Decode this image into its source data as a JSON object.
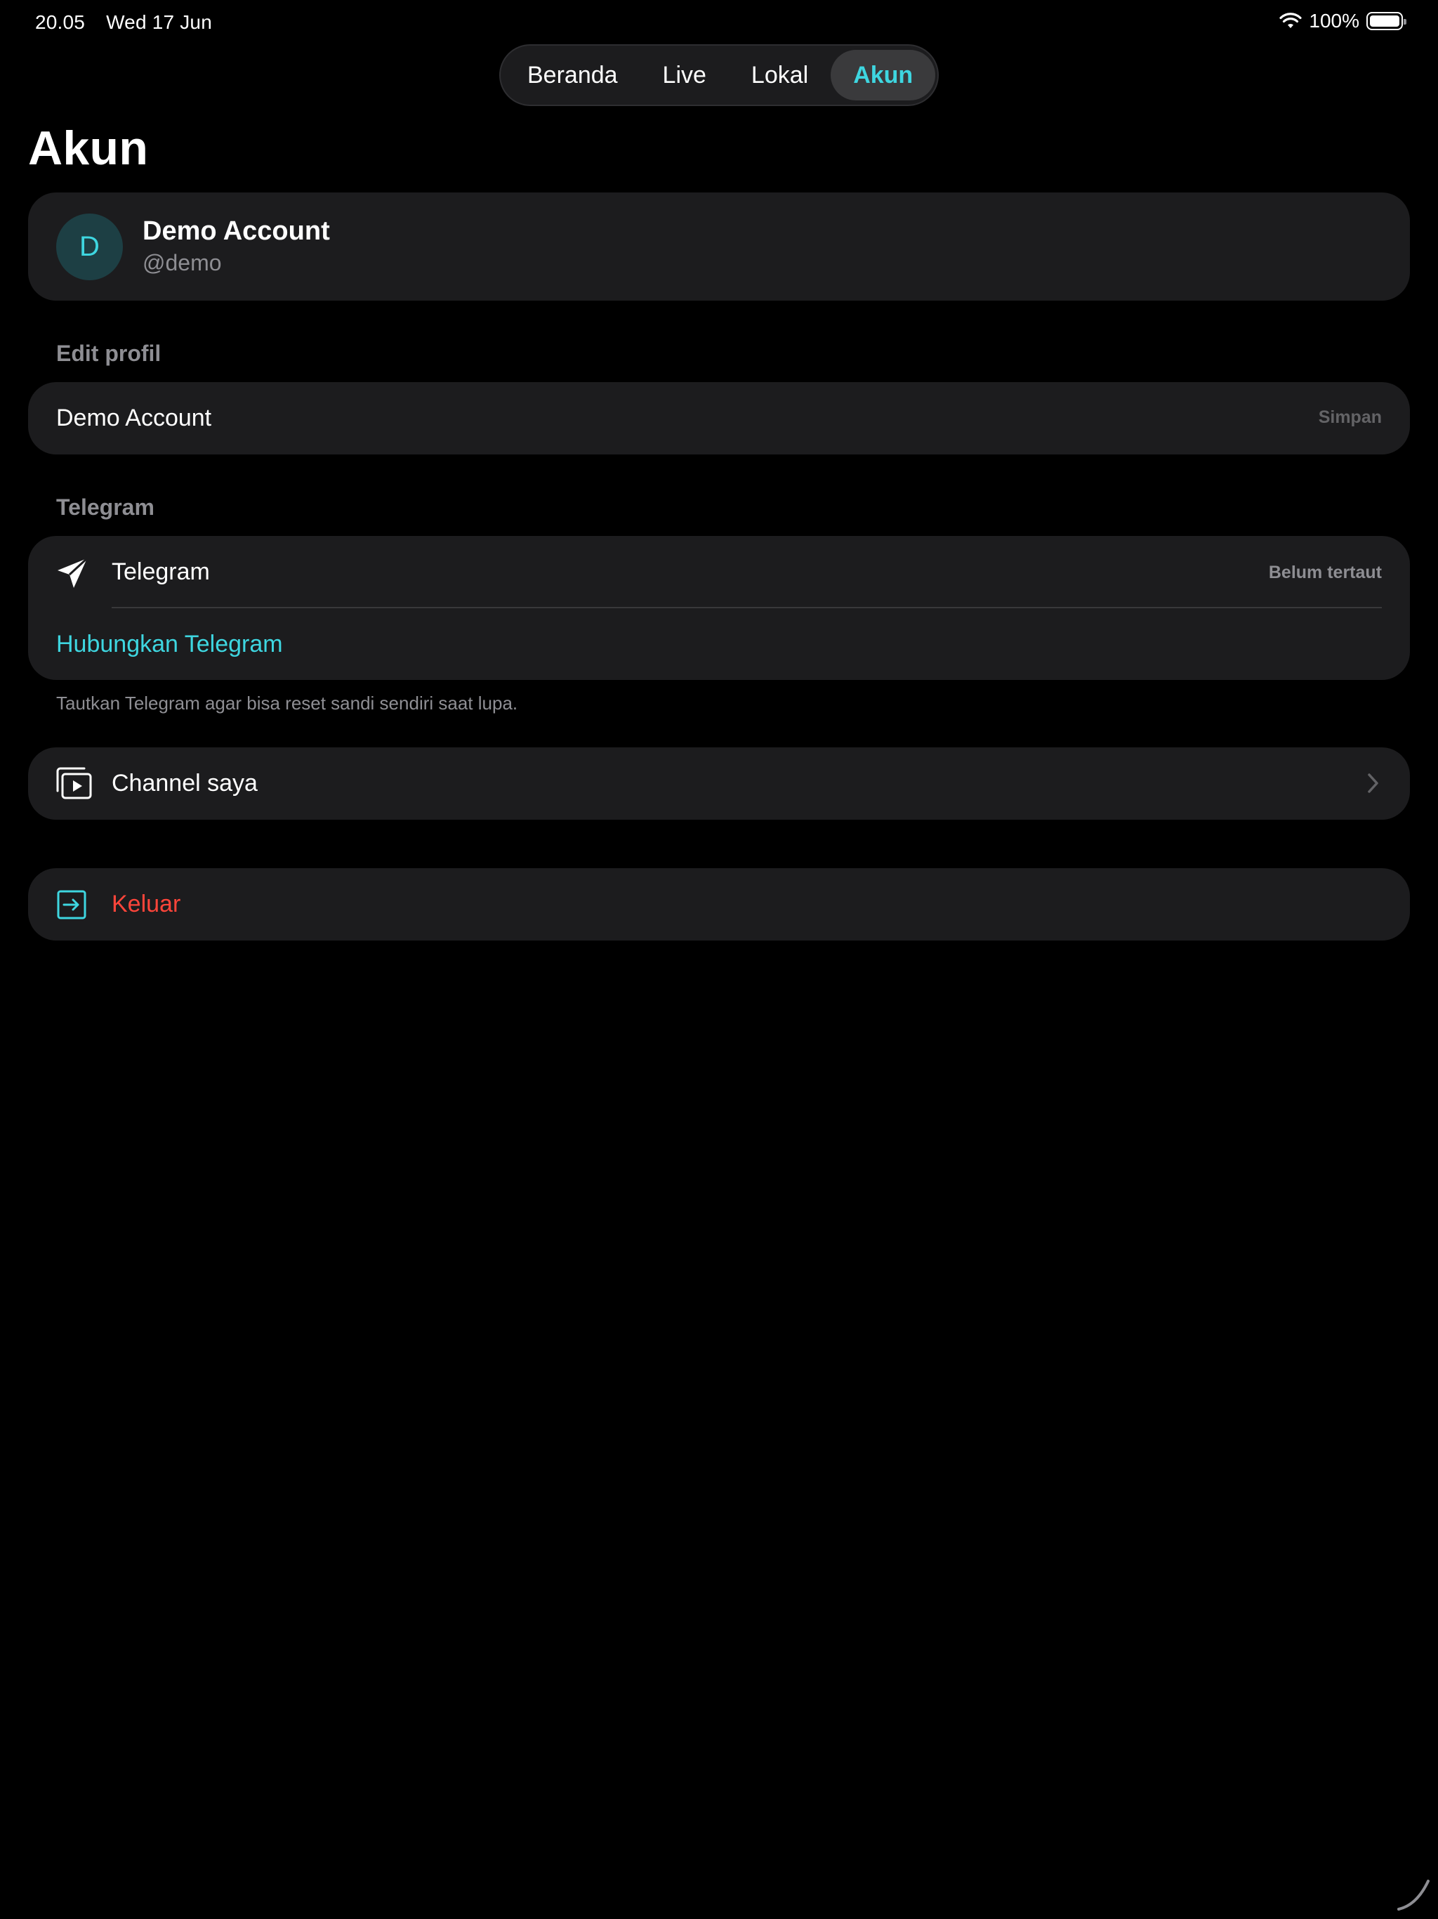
{
  "status_bar": {
    "time": "20.05",
    "date": "Wed 17 Jun",
    "battery_text": "100%",
    "battery_level": 1.0
  },
  "tabs": [
    {
      "label": "Beranda",
      "active": false
    },
    {
      "label": "Live",
      "active": false
    },
    {
      "label": "Lokal",
      "active": false
    },
    {
      "label": "Akun",
      "active": true
    }
  ],
  "page_title": "Akun",
  "profile": {
    "avatar_initial": "D",
    "name": "Demo Account",
    "handle": "@demo"
  },
  "edit_profile": {
    "section_label": "Edit profil",
    "name_value": "Demo Account",
    "save_label": "Simpan"
  },
  "telegram": {
    "section_label": "Telegram",
    "label": "Telegram",
    "status": "Belum tertaut",
    "connect_label": "Hubungkan Telegram",
    "hint": "Tautkan Telegram agar bisa reset sandi sendiri saat lupa."
  },
  "channel": {
    "label": "Channel saya"
  },
  "logout": {
    "label": "Keluar"
  },
  "colors": {
    "background": "#000000",
    "card": "#1c1c1e",
    "accent": "#3ed6e0",
    "destructive": "#ff453a",
    "secondary_text": "#8e8e93"
  },
  "icons": {
    "telegram": "paper-plane-icon",
    "channel": "play-stack-icon",
    "logout": "exit-arrow-icon",
    "wifi": "wifi-icon",
    "battery": "battery-icon",
    "chevron": "chevron-right-icon"
  }
}
